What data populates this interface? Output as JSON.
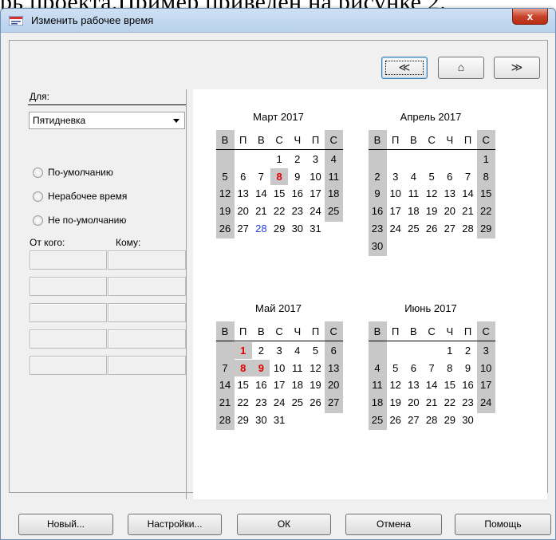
{
  "background_text": "рь проекта.Пример приведен на рисунке 2.",
  "window": {
    "title": "Изменить рабочее время",
    "close_label": "x"
  },
  "nav": {
    "prev": "≪",
    "home": "⌂",
    "next": "≫"
  },
  "left": {
    "for_label": "Для:",
    "calendar_value": "Пятидневка",
    "radios": [
      "По-умолчанию",
      "Нерабочее время",
      "Не по-умолчанию"
    ],
    "from_label": "От кого:",
    "to_label": "Кому:"
  },
  "colors": {
    "weekend_gray": "#c8c8c8",
    "holiday_red": "#e00000",
    "today_blue": "#2040e0"
  },
  "calendars": [
    {
      "title": "Март 2017",
      "weekdays": [
        "В",
        "П",
        "В",
        "С",
        "Ч",
        "П",
        "С"
      ],
      "weeks": [
        [
          "",
          "",
          "",
          "1",
          "2",
          "3",
          "4"
        ],
        [
          "5",
          "6",
          "7",
          "8",
          "9",
          "10",
          "11"
        ],
        [
          "12",
          "13",
          "14",
          "15",
          "16",
          "17",
          "18"
        ],
        [
          "19",
          "20",
          "21",
          "22",
          "23",
          "24",
          "25"
        ],
        [
          "26",
          "27",
          "28",
          "29",
          "30",
          "31",
          ""
        ]
      ],
      "red_days": [
        "8"
      ],
      "blue_days": [
        "28"
      ]
    },
    {
      "title": "Апрель 2017",
      "weekdays": [
        "В",
        "П",
        "В",
        "С",
        "Ч",
        "П",
        "С"
      ],
      "weeks": [
        [
          "",
          "",
          "",
          "",
          "",
          "",
          "1"
        ],
        [
          "2",
          "3",
          "4",
          "5",
          "6",
          "7",
          "8"
        ],
        [
          "9",
          "10",
          "11",
          "12",
          "13",
          "14",
          "15"
        ],
        [
          "16",
          "17",
          "18",
          "19",
          "20",
          "21",
          "22"
        ],
        [
          "23",
          "24",
          "25",
          "26",
          "27",
          "28",
          "29"
        ],
        [
          "30",
          "",
          "",
          "",
          "",
          "",
          ""
        ]
      ],
      "red_days": [],
      "blue_days": []
    },
    {
      "title": "Май 2017",
      "weekdays": [
        "В",
        "П",
        "В",
        "С",
        "Ч",
        "П",
        "С"
      ],
      "weeks": [
        [
          "",
          "1",
          "2",
          "3",
          "4",
          "5",
          "6"
        ],
        [
          "7",
          "8",
          "9",
          "10",
          "11",
          "12",
          "13"
        ],
        [
          "14",
          "15",
          "16",
          "17",
          "18",
          "19",
          "20"
        ],
        [
          "21",
          "22",
          "23",
          "24",
          "25",
          "26",
          "27"
        ],
        [
          "28",
          "29",
          "30",
          "31",
          "",
          "",
          ""
        ]
      ],
      "red_days": [
        "1",
        "8",
        "9"
      ],
      "blue_days": []
    },
    {
      "title": "Июнь 2017",
      "weekdays": [
        "В",
        "П",
        "В",
        "С",
        "Ч",
        "П",
        "С"
      ],
      "weeks": [
        [
          "",
          "",
          "",
          "",
          "1",
          "2",
          "3"
        ],
        [
          "4",
          "5",
          "6",
          "7",
          "8",
          "9",
          "10"
        ],
        [
          "11",
          "12",
          "13",
          "14",
          "15",
          "16",
          "17"
        ],
        [
          "18",
          "19",
          "20",
          "21",
          "22",
          "23",
          "24"
        ],
        [
          "25",
          "26",
          "27",
          "28",
          "29",
          "30",
          ""
        ]
      ],
      "red_days": [],
      "blue_days": []
    }
  ],
  "buttons": {
    "new": "Новый...",
    "settings": "Настройки...",
    "ok": "ОК",
    "cancel": "Отмена",
    "help": "Помощь"
  }
}
